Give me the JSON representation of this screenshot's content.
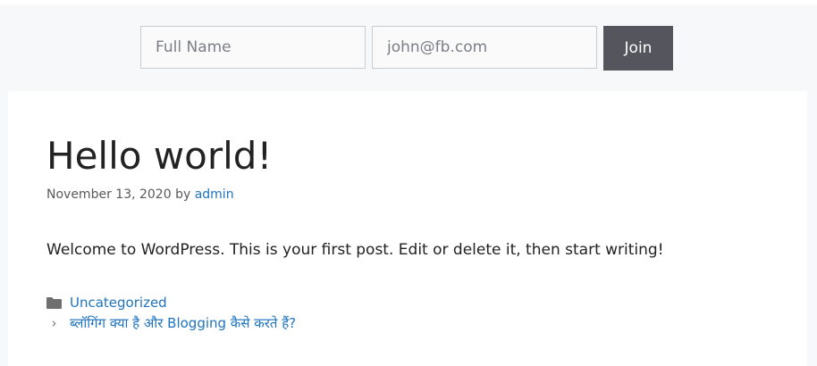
{
  "signup": {
    "name_placeholder": "Full Name",
    "email_placeholder": "john@fb.com",
    "join_label": "Join"
  },
  "post": {
    "title": "Hello world!",
    "date": "November 13, 2020",
    "by_label": "by",
    "author": "admin",
    "body": "Welcome to WordPress. This is your first post. Edit or delete it, then start writing!",
    "category": "Uncategorized",
    "next_post": "ब्लॉगिंग क्या है और Blogging कैसे करते हैं?"
  },
  "icons": {
    "category": "folder-icon",
    "next": "chevron-right-icon"
  },
  "colors": {
    "link": "#1e73be",
    "button_bg": "#55555e",
    "page_bg": "#f7f8f9"
  }
}
